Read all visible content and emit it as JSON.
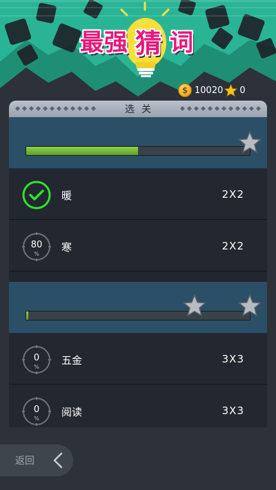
{
  "app": {
    "title_part1": "最强",
    "title_part2": "猜",
    "title_part3": "词"
  },
  "currency": {
    "coins": "10020",
    "stars": "0"
  },
  "panel": {
    "title": "选关"
  },
  "groups": [
    {
      "progress": 0.5,
      "stars": 1
    },
    {
      "progress": 0.01,
      "stars": 2
    }
  ],
  "levels": [
    {
      "name": "暖",
      "size": "2X2",
      "status": "complete"
    },
    {
      "name": "寒",
      "size": "2X2",
      "status": "progress",
      "percent": "80",
      "percent_sign": "%"
    },
    {
      "name": "五金",
      "size": "3X3",
      "status": "progress",
      "percent": "0",
      "percent_sign": "%"
    },
    {
      "name": "阅读",
      "size": "3X3",
      "status": "progress",
      "percent": "0",
      "percent_sign": "%"
    }
  ],
  "back": {
    "label": "返回"
  },
  "colors": {
    "accent_green": "#2fe42f",
    "title_pink": "#e8167c",
    "header_bg": "#2ab89a",
    "group_bg": "#2b4f66",
    "progress_green": "#6db32f"
  }
}
